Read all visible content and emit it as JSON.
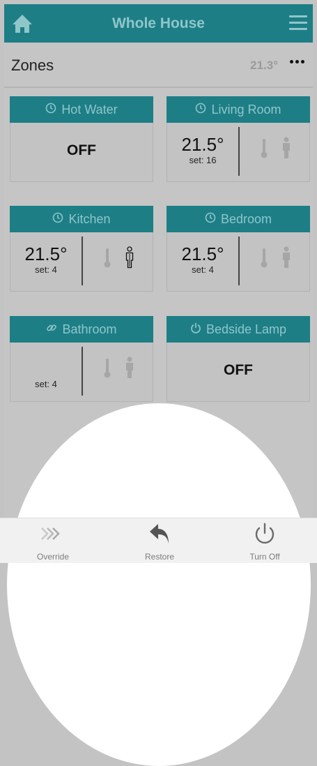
{
  "header": {
    "title": "Whole House"
  },
  "zones": {
    "label": "Zones",
    "temperature": "21.3°"
  },
  "cards": [
    {
      "name": "Hot Water",
      "icon": "clock-icon",
      "state": "OFF"
    },
    {
      "name": "Living Room",
      "icon": "clock-icon",
      "temp": "21.5°",
      "set": "set: 16"
    },
    {
      "name": "Kitchen",
      "icon": "clock-icon",
      "temp": "21.5°",
      "set": "set: 4",
      "occupied": true
    },
    {
      "name": "Bedroom",
      "icon": "clock-icon",
      "temp": "21.5°",
      "set": "set: 4"
    },
    {
      "name": "Bathroom",
      "icon": "link-icon",
      "temp": "",
      "set": "set: 4"
    },
    {
      "name": "Bedside Lamp",
      "icon": "power-icon",
      "state": "OFF"
    }
  ],
  "bottom_bar": {
    "override": "Override",
    "restore": "Restore",
    "turn_off": "Turn Off"
  },
  "colors": {
    "header_bg": "#1d7e86",
    "header_text": "#8fc6ca",
    "page_bg": "#c5c5c5"
  }
}
